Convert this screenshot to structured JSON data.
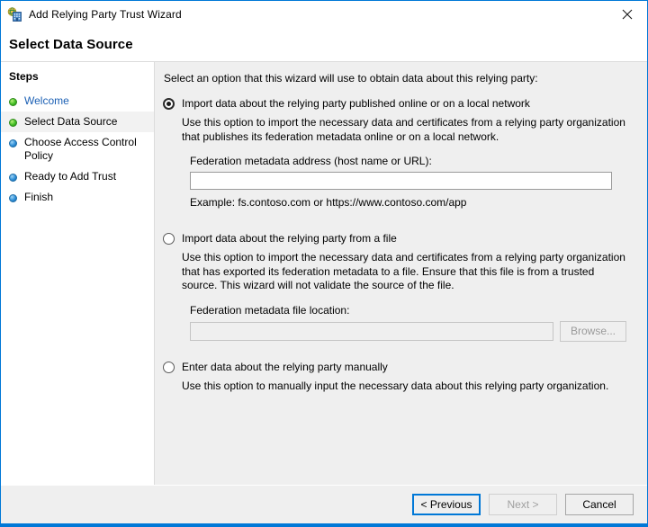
{
  "window": {
    "title": "Add Relying Party Trust Wizard",
    "icon": "adfs-relying-party-icon",
    "close_label": "close-icon",
    "accent_color": "#0078d7"
  },
  "header": {
    "title": "Select Data Source"
  },
  "sidebar": {
    "heading": "Steps",
    "items": [
      {
        "label": "Welcome",
        "bullet": "green",
        "state": "completed-link"
      },
      {
        "label": "Select Data Source",
        "bullet": "green",
        "state": "current"
      },
      {
        "label": "Choose Access Control Policy",
        "bullet": "blue",
        "state": "pending"
      },
      {
        "label": "Ready to Add Trust",
        "bullet": "blue",
        "state": "pending"
      },
      {
        "label": "Finish",
        "bullet": "blue",
        "state": "pending"
      }
    ]
  },
  "main": {
    "intro": "Select an option that this wizard will use to obtain data about this relying party:",
    "options": [
      {
        "title": "Import data about the relying party published online or on a local network",
        "selected": true,
        "description": "Use this option to import the necessary data and certificates from a relying party organization that publishes its federation metadata online or on a local network.",
        "field_label": "Federation metadata address (host name or URL):",
        "field_value": "",
        "field_placeholder": "",
        "example": "Example: fs.contoso.com or https://www.contoso.com/app"
      },
      {
        "title": "Import data about the relying party from a file",
        "selected": false,
        "description": "Use this option to import the necessary data and certificates from a relying party organization that has exported its federation metadata to a file. Ensure that this file is from a trusted source.  This wizard will not validate the source of the file.",
        "field_label": "Federation metadata file location:",
        "field_value": "",
        "field_placeholder": "",
        "browse_label": "Browse...",
        "browse_disabled": true,
        "field_disabled": true
      },
      {
        "title": "Enter data about the relying party manually",
        "selected": false,
        "description": "Use this option to manually input the necessary data about this relying party organization."
      }
    ]
  },
  "footer": {
    "previous_label": "< Previous",
    "next_label": "Next >",
    "cancel_label": "Cancel",
    "next_disabled": true,
    "previous_is_default": true
  }
}
